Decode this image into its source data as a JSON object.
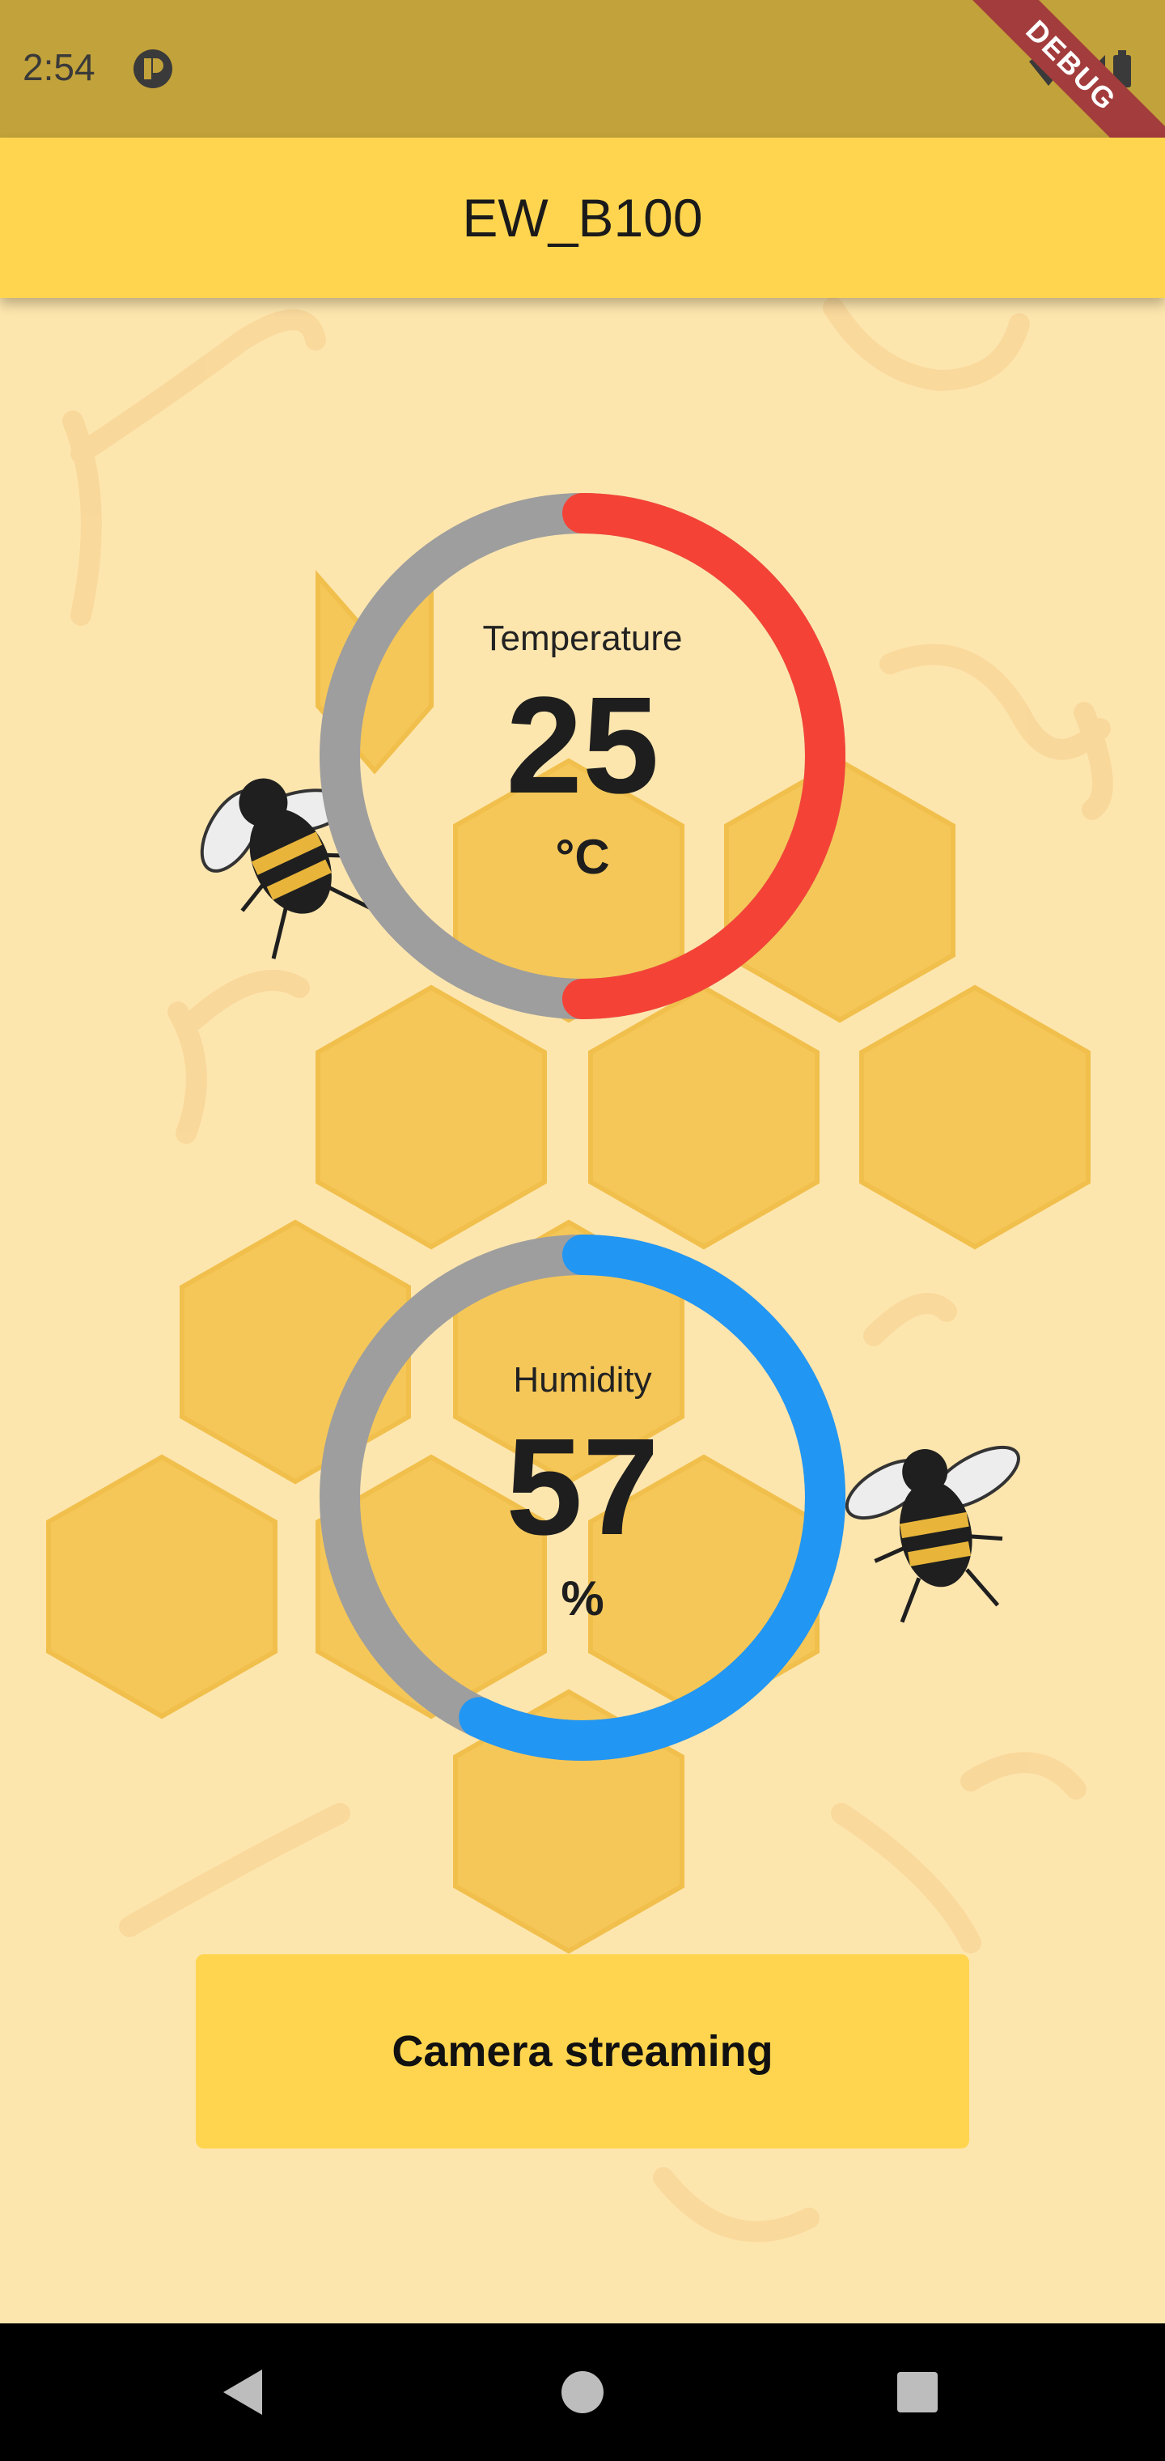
{
  "status_bar": {
    "time": "2:54"
  },
  "debug_banner": "DEBUG",
  "app_bar": {
    "title": "EW_B100"
  },
  "temperature": {
    "label": "Temperature",
    "value": "25",
    "unit": "°C",
    "fraction": 0.5,
    "color": "#F44336"
  },
  "humidity": {
    "label": "Humidity",
    "value": "57",
    "unit": "%",
    "fraction": 0.57,
    "color": "#2196F3"
  },
  "gauge_track_color": "#9E9E9E",
  "camera_button": {
    "label": "Camera streaming"
  },
  "colors": {
    "background": "#FDE6AE",
    "app_bar": "#FFD54F",
    "status_bar": "#C2A23A",
    "honeycomb": "#F4C24A"
  },
  "nav": {
    "back": "back-icon",
    "home": "home-icon",
    "recents": "recents-icon"
  }
}
